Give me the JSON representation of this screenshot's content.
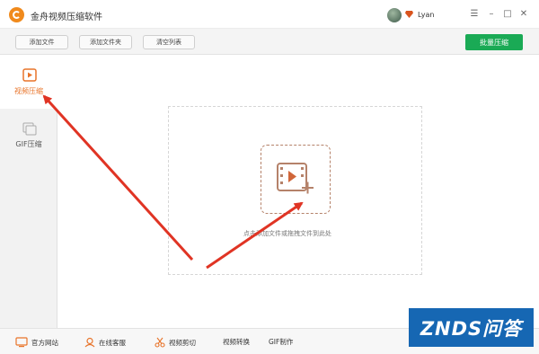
{
  "app": {
    "title": "金舟视频压缩软件",
    "username": "Lyan"
  },
  "window_controls": {
    "menu": "☰",
    "minimize": "–",
    "maximize": "□",
    "close": "✕"
  },
  "toolbar": {
    "add_file": "添加文件",
    "add_folder": "添加文件夹",
    "clear_list": "清空列表",
    "batch_compress": "批量压缩"
  },
  "sidebar": {
    "items": [
      {
        "label": "视频压缩",
        "icon": "video-compress-icon",
        "active": true
      },
      {
        "label": "GIF压缩",
        "icon": "gif-compress-icon",
        "active": false
      }
    ]
  },
  "main": {
    "drop_hint": "点击添加文件或拖拽文件到此处"
  },
  "statusbar": {
    "website": "官方网站",
    "support": "在线客服",
    "video_cut": "视频剪切",
    "video_convert": "视频转换",
    "gif_make": "GIF制作"
  },
  "watermark": {
    "text": "ZNDS问答"
  },
  "colors": {
    "accent": "#f08a1c",
    "primary_button": "#1aaa55",
    "active_sidebar_text": "#e8742a",
    "annotation_arrow": "#e03424",
    "watermark_bg": "#1667b3"
  }
}
